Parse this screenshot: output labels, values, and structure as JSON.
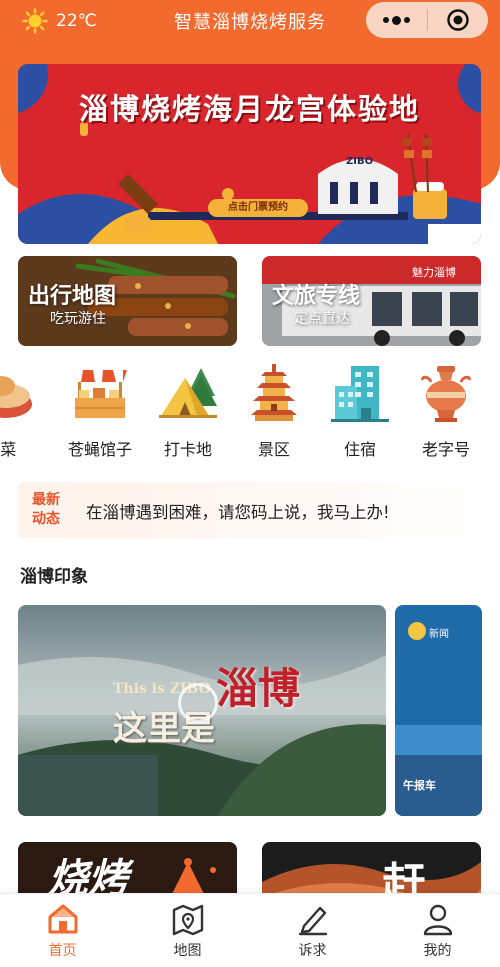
{
  "header": {
    "temperature": "22℃",
    "title": "智慧淄博烧烤服务",
    "weather_icon": "sun-icon",
    "capsule_icons": [
      "more-dots-icon",
      "target-icon"
    ]
  },
  "banner": {
    "title": "淄博烧烤海月龙宫体验地",
    "button_label": "点击门票预约",
    "sign_text": "ZIBO"
  },
  "features": [
    {
      "title": "出行地图",
      "subtitle": "吃玩游住"
    },
    {
      "title": "文旅专线",
      "subtitle": "定点直达"
    }
  ],
  "categories": [
    {
      "label": "l菜",
      "icon": "dish-icon"
    },
    {
      "label": "苍蝇馆子",
      "icon": "food-stall-icon"
    },
    {
      "label": "打卡地",
      "icon": "tent-icon"
    },
    {
      "label": "景区",
      "icon": "pagoda-icon"
    },
    {
      "label": "住宿",
      "icon": "hotel-icon"
    },
    {
      "label": "老字号",
      "icon": "vase-icon"
    }
  ],
  "news": {
    "tag_line1": "最新",
    "tag_line2": "动态",
    "text": "在淄博遇到困难，请您码上说，我马上办!"
  },
  "section": {
    "title": "淄博印象"
  },
  "video": {
    "caption_en": "This is ZIBO",
    "caption_cn": "这里是",
    "calligraphy": "淄博",
    "side_logo": "新闻",
    "side_label": "午报车"
  },
  "bottom_cards": [
    {
      "text": "烧烤"
    },
    {
      "text": "赶"
    }
  ],
  "tabbar": {
    "tabs": [
      {
        "label": "首页",
        "icon": "home-icon",
        "active": true
      },
      {
        "label": "地图",
        "icon": "map-icon",
        "active": false
      },
      {
        "label": "诉求",
        "icon": "edit-icon",
        "active": false
      },
      {
        "label": "我的",
        "icon": "user-icon",
        "active": false
      }
    ]
  },
  "colors": {
    "brand": "#f26a2e",
    "banner_red": "#d8262c",
    "news_tag": "#e8542a"
  }
}
